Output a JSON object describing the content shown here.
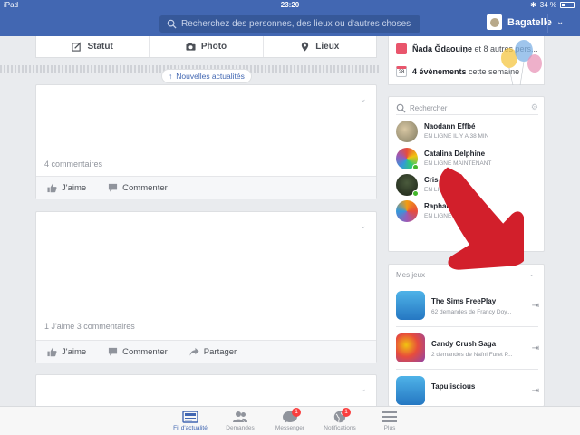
{
  "status_bar": {
    "carrier": "iPad",
    "time": "23:20",
    "battery": "34 %"
  },
  "header": {
    "search_placeholder": "Recherchez des personnes, des lieux ou d'autres choses",
    "profile_name": "Bagatelle"
  },
  "composer": {
    "status_label": "Statut",
    "photo_label": "Photo",
    "places_label": "Lieux"
  },
  "feed": {
    "new_stories_label": "Nouvelles actualités",
    "posts": [
      {
        "counts": "4 commentaires",
        "like_label": "J'aime",
        "comment_label": "Commenter"
      },
      {
        "counts": "1 J'aime  3 commentaires",
        "like_label": "J'aime",
        "comment_label": "Commenter",
        "share_label": "Partager"
      }
    ]
  },
  "events": {
    "birthday_name": "Ñada Ğdaouiņe",
    "birthday_rest": " et 8 autres pers...",
    "events_count": "4 évènements",
    "events_rest": " cette semaine",
    "calendar_day": "28"
  },
  "chat": {
    "search_placeholder": "Rechercher",
    "friends": [
      {
        "name": "Naodann Effbé",
        "status": "EN LIGNE IL Y A 38 MIN",
        "online": false
      },
      {
        "name": "Catalina Delphine",
        "status": "EN LIGNE MAINTENANT",
        "online": true
      },
      {
        "name": "Cris Telf",
        "status": "EN LIGNE",
        "online": true
      },
      {
        "name": "Raphaëlle",
        "status": "EN LIGNE IL Y A",
        "online": false
      }
    ]
  },
  "games": {
    "title": "Mes jeux",
    "items": [
      {
        "name": "The Sims FreePlay",
        "requests": "62 demandes de Francy Doy..."
      },
      {
        "name": "Candy Crush Saga",
        "requests": "2 demandes de Naïni Furet P..."
      },
      {
        "name": "Tapuliscious",
        "requests": ""
      }
    ]
  },
  "tabbar": {
    "items": [
      {
        "label": "Fil d'actualité",
        "badge": ""
      },
      {
        "label": "Demandes",
        "badge": ""
      },
      {
        "label": "Messenger",
        "badge": "1"
      },
      {
        "label": "Notifications",
        "badge": "1"
      },
      {
        "label": "Plus",
        "badge": ""
      }
    ]
  },
  "colors": {
    "brand": "#4267b2",
    "annotation_arrow": "#d21f2b",
    "online": "#42b72a",
    "badge": "#fa3e3e"
  }
}
